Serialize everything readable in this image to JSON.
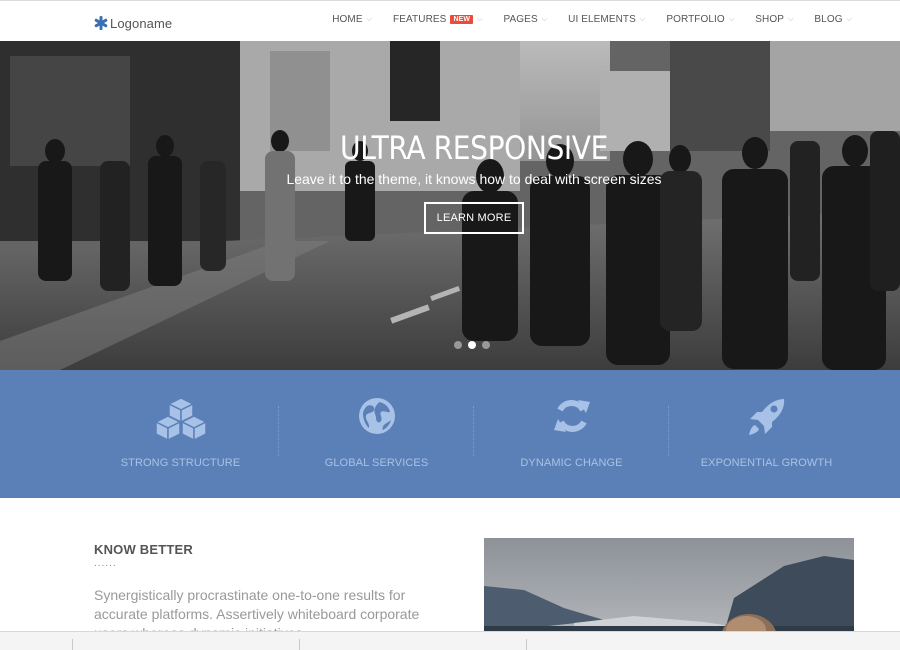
{
  "header": {
    "logo_text": "Logoname",
    "nav": [
      {
        "label": "HOME",
        "badge": ""
      },
      {
        "label": "FEATURES",
        "badge": "NEW"
      },
      {
        "label": "PAGES",
        "badge": ""
      },
      {
        "label": "UI ELEMENTS",
        "badge": ""
      },
      {
        "label": "PORTFOLIO",
        "badge": ""
      },
      {
        "label": "SHOP",
        "badge": ""
      },
      {
        "label": "BLOG",
        "badge": ""
      }
    ]
  },
  "hero": {
    "title": "ULTRA RESPONSIVE",
    "subtitle": "Leave it to the theme, it knows how to deal with screen sizes",
    "button": "LEARN MORE",
    "slides": 3,
    "active_slide": 2
  },
  "features": [
    {
      "label": "STRONG STRUCTURE",
      "icon": "cubes-icon"
    },
    {
      "label": "GLOBAL SERVICES",
      "icon": "globe-icon"
    },
    {
      "label": "DYNAMIC CHANGE",
      "icon": "refresh-icon"
    },
    {
      "label": "EXPONENTIAL GROWTH",
      "icon": "rocket-icon"
    }
  ],
  "content": {
    "title": "KNOW BETTER",
    "dots": "......",
    "text": "Synergistically procrastinate one-to-one results for accurate platforms. Assertively whiteboard corporate users whereas dynamic initiatives."
  },
  "colors": {
    "accent": "#5b80b7",
    "feature_text": "#a8c1e6",
    "badge": "#e74c3c",
    "logo": "#3a6fb0"
  }
}
